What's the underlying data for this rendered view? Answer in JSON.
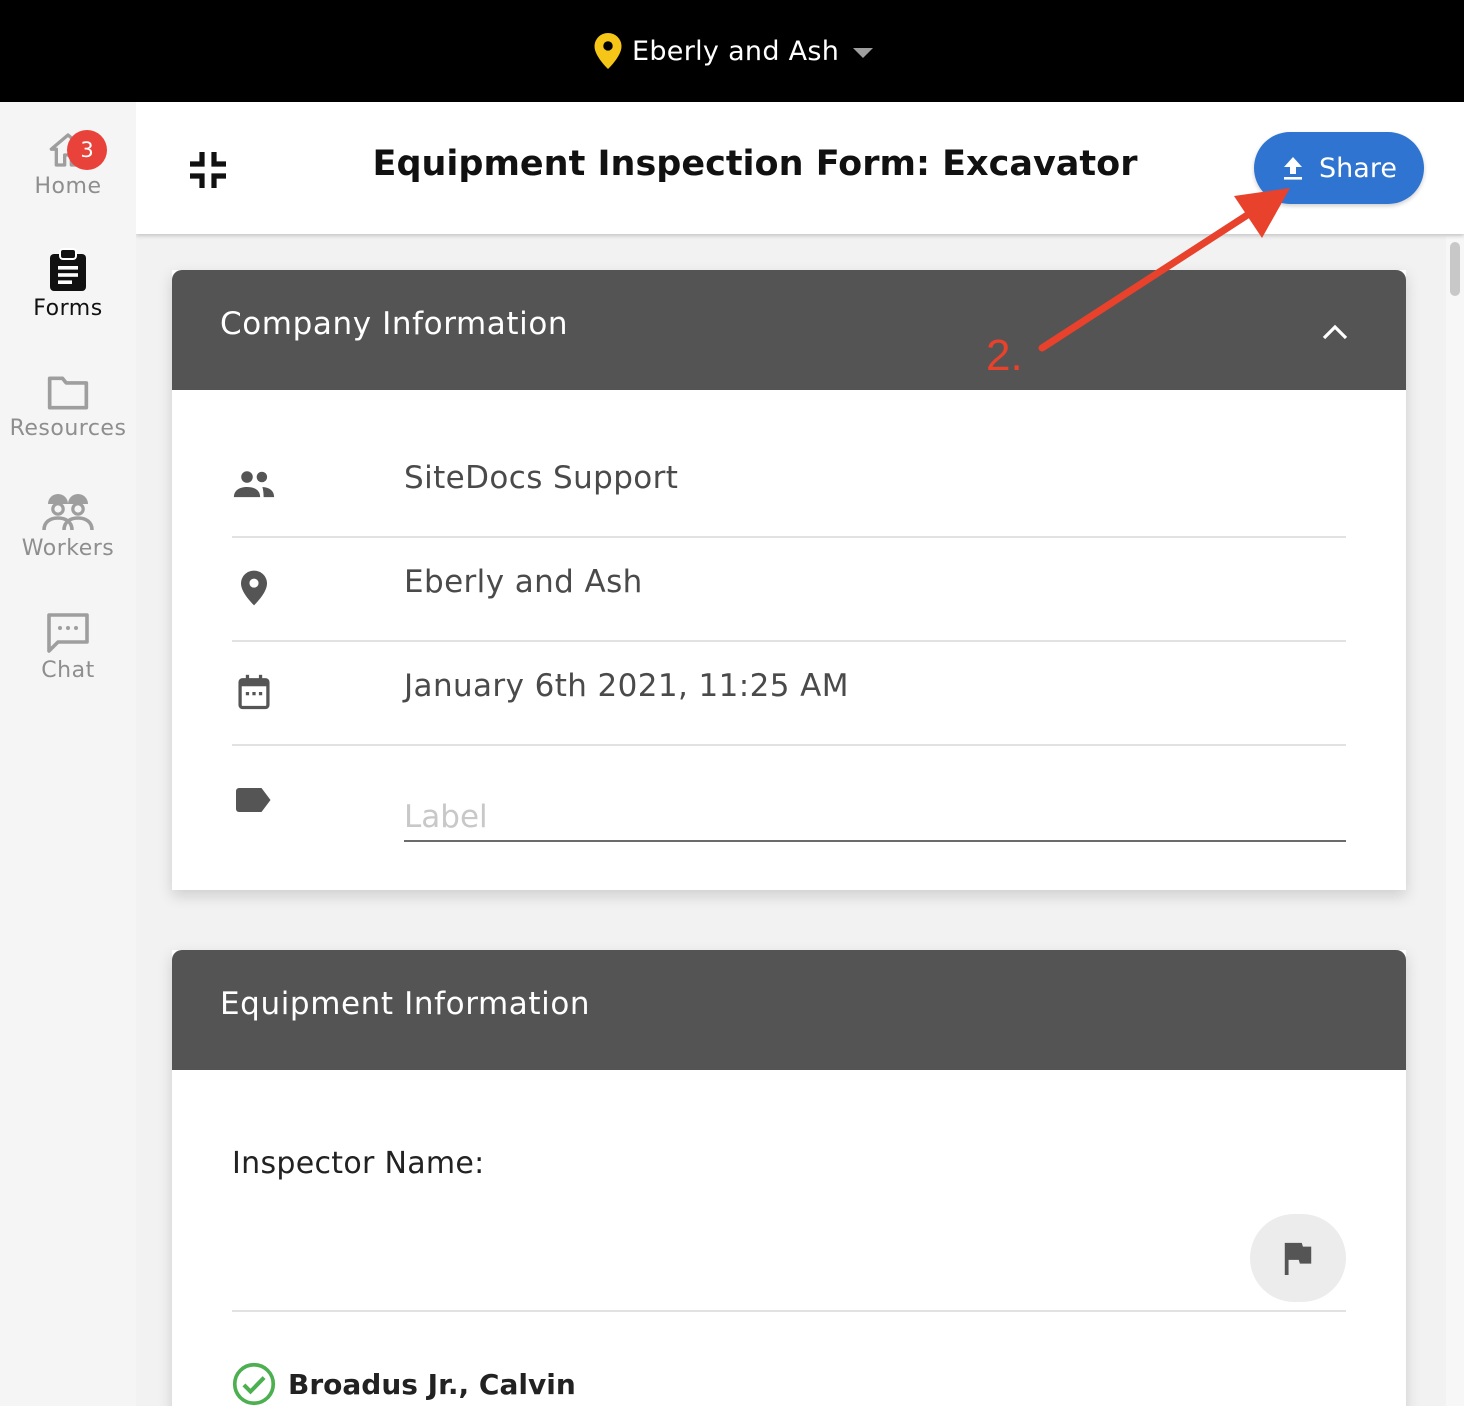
{
  "topbar": {
    "site_name": "Eberly and Ash"
  },
  "sidebar": {
    "items": [
      {
        "label": "Home",
        "badge": "3"
      },
      {
        "label": "Forms"
      },
      {
        "label": "Resources"
      },
      {
        "label": "Workers"
      },
      {
        "label": "Chat"
      }
    ]
  },
  "header": {
    "title": "Equipment Inspection Form: Excavator",
    "share_label": "Share"
  },
  "company_section": {
    "title": "Company Information",
    "company": "SiteDocs Support",
    "location": "Eberly and Ash",
    "date": "January 6th 2021, 11:25 AM",
    "label_placeholder": "Label"
  },
  "equipment_section": {
    "title": "Equipment Information",
    "inspector_label": "Inspector Name:",
    "inspector": "Broadus Jr., Calvin"
  },
  "annotation": {
    "text": "2.",
    "color": "#e8412c"
  },
  "colors": {
    "accent": "#2f74d0",
    "badge": "#e8423b",
    "pin": "#f5c518",
    "check": "#4caf50",
    "section_header": "#545454"
  }
}
